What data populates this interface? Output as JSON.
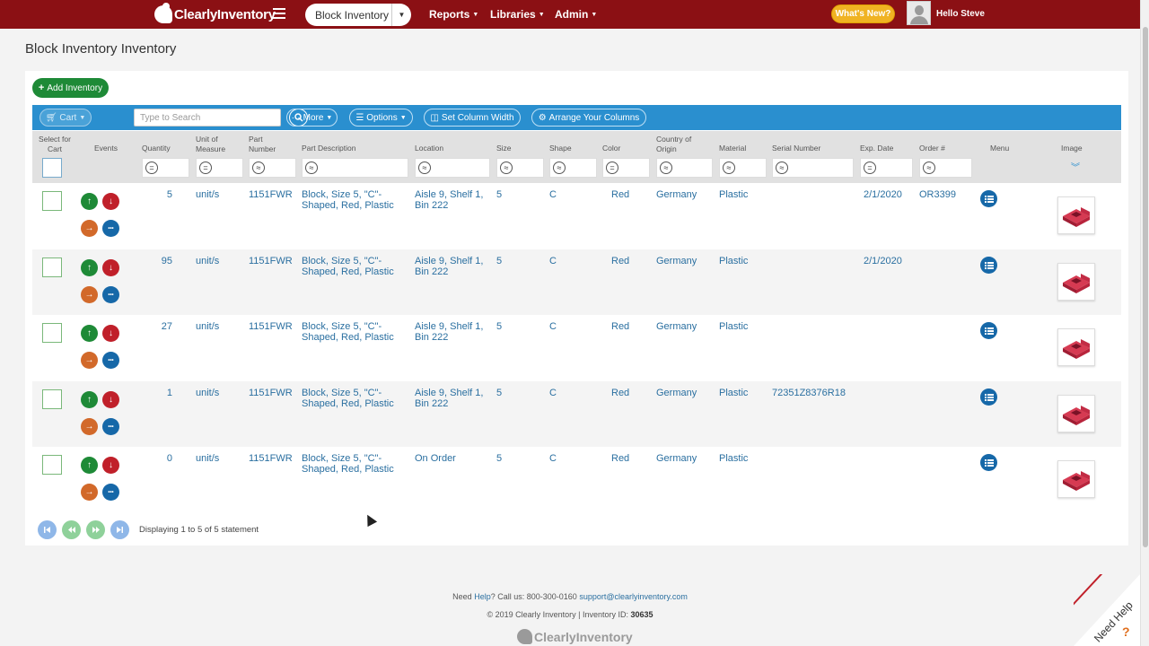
{
  "nav": {
    "brand": "ClearlyInventory",
    "module": "Block Inventory",
    "menus": [
      "Reports",
      "Libraries",
      "Admin"
    ],
    "whats_new": "What's New?",
    "greeting": "Hello Steve",
    "color": "#8b1014"
  },
  "page": {
    "title": "Block Inventory Inventory"
  },
  "actions": {
    "add": "Add Inventory"
  },
  "toolbar": {
    "cart": "Cart",
    "search_placeholder": "Type to Search",
    "more": "More",
    "options": "Options",
    "set_width": "Set Column Width",
    "arrange": "Arrange Your Columns",
    "color": "#2a8fcf"
  },
  "columns": {
    "select": "Select for Cart",
    "events": "Events",
    "quantity": "Quantity",
    "uom": "Unit of Measure",
    "part_number": "Part Number",
    "description": "Part Description",
    "location": "Location",
    "size": "Size",
    "shape": "Shape",
    "color": "Color",
    "origin": "Country of Origin",
    "material": "Material",
    "serial": "Serial Number",
    "exp_date": "Exp. Date",
    "order": "Order #",
    "menu": "Menu",
    "image": "Image"
  },
  "filter_ops": {
    "quantity": "=",
    "uom": "=",
    "part_number": "≈",
    "description": "≈",
    "location": "≈",
    "size": "≈",
    "shape": "≈",
    "color": "=",
    "origin": "≈",
    "material": "≈",
    "serial": "≈",
    "exp_date": "=",
    "order": "≈"
  },
  "rows": [
    {
      "quantity": "5",
      "uom": "unit/s",
      "part_number": "1151FWR",
      "description": "Block, Size 5, \"C\"-Shaped, Red, Plastic",
      "location": "Aisle 9, Shelf 1, Bin 222",
      "size": "5",
      "shape": "C",
      "color": "Red",
      "origin": "Germany",
      "material": "Plastic",
      "serial": "",
      "exp_date": "2/1/2020",
      "order": "OR3399"
    },
    {
      "quantity": "95",
      "uom": "unit/s",
      "part_number": "1151FWR",
      "description": "Block, Size 5, \"C\"-Shaped, Red, Plastic",
      "location": "Aisle 9, Shelf 1, Bin 222",
      "size": "5",
      "shape": "C",
      "color": "Red",
      "origin": "Germany",
      "material": "Plastic",
      "serial": "",
      "exp_date": "2/1/2020",
      "order": ""
    },
    {
      "quantity": "27",
      "uom": "unit/s",
      "part_number": "1151FWR",
      "description": "Block, Size 5, \"C\"-Shaped, Red, Plastic",
      "location": "Aisle 9, Shelf 1, Bin 222",
      "size": "5",
      "shape": "C",
      "color": "Red",
      "origin": "Germany",
      "material": "Plastic",
      "serial": "",
      "exp_date": "",
      "order": ""
    },
    {
      "quantity": "1",
      "uom": "unit/s",
      "part_number": "1151FWR",
      "description": "Block, Size 5, \"C\"-Shaped, Red, Plastic",
      "location": "Aisle 9, Shelf 1, Bin 222",
      "size": "5",
      "shape": "C",
      "color": "Red",
      "origin": "Germany",
      "material": "Plastic",
      "serial": "72351Z8376R18",
      "exp_date": "",
      "order": ""
    },
    {
      "quantity": "0",
      "uom": "unit/s",
      "part_number": "1151FWR",
      "description": "Block, Size 5, \"C\"-Shaped, Red, Plastic",
      "location": "On Order",
      "size": "5",
      "shape": "C",
      "color": "Red",
      "origin": "Germany",
      "material": "Plastic",
      "serial": "",
      "exp_date": "",
      "order": ""
    }
  ],
  "pagination": {
    "text": "Displaying 1 to 5 of 5 statement"
  },
  "footer": {
    "need": "Need",
    "help_link": "Help",
    "call": "? Call us: 800-300-0160",
    "email": "support@clearlyinventory.com",
    "copyright": "© 2019 Clearly Inventory | Inventory ID:",
    "inventory_id": "30635",
    "brand": "ClearlyInventory",
    "need_help": "Need Help"
  }
}
